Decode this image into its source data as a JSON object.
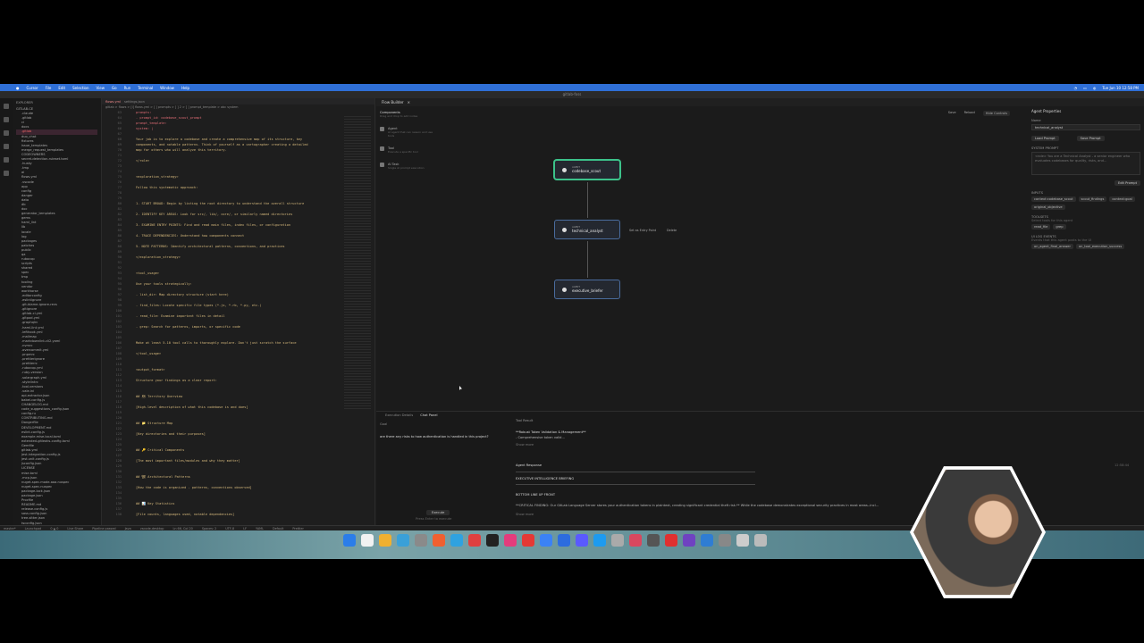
{
  "menubar": {
    "items": [
      "Cursor",
      "File",
      "Edit",
      "Selection",
      "View",
      "Go",
      "Run",
      "Terminal",
      "Window",
      "Help"
    ],
    "clock": "Tue Jun 10 12:58 PM"
  },
  "window_title": "gitlab-foss",
  "explorer": {
    "header": "EXPLORER",
    "root": "GITLAB-CE",
    "items": [
      ".claude",
      ".gitlab",
      "ci",
      "docs",
      ".gitlab",
      "duo_chat",
      "fixtures",
      "issue_templates",
      "merge_request_templates",
      "CODEOWNERS",
      "secret-detection-ruleset.toml",
      ".husky",
      ".tmp",
      "ai",
      "flows.yml",
      ".vscode",
      "app",
      "config",
      "danger",
      "data",
      "db",
      "doc",
      "generator_templates",
      "gems",
      "haml_lint",
      "lib",
      "locale",
      "log",
      "packages",
      "patches",
      "public",
      "qa",
      "rubocop",
      "scripts",
      "shared",
      "spec",
      "tmp",
      "tooling",
      "vendor",
      "workhorse",
      ".editorconfig",
      ".eslintignore",
      ".git-blame-ignore-revs",
      ".gitignore",
      ".gitlab-ci.yml",
      ".gitpod.yml",
      ".graphqlrc",
      ".haml-lint.yml",
      ".lefthook.yml",
      ".mailmap",
      ".markdownlint-cli2.yaml",
      ".nvmrc",
      ".overcommit.yml",
      ".pnpmrc",
      ".prettierignore",
      ".prettierrc",
      ".rubocop.yml",
      ".ruby-version",
      ".solargraph.yml",
      ".stylelintrc",
      ".tool-versions",
      ".vale.ini",
      "api-extractor.json",
      "babel.config.js",
      "CHANGELOG.md",
      "code_suggestions_config.json",
      "config.ru",
      "CONTRIBUTING.md",
      "Dangerfile",
      "DEVELOPMENT.md",
      "eslint.config.js",
      "example.mise.local.toml",
      "extended-gitleaks-config.toml",
      "Gemfile",
      "gitlab.yml",
      "jest.integration.config.js",
      "jest.unit.config.js",
      "jsconfig.json",
      "LICENSE",
      "mise.toml",
      ".mcp.json",
      "nuget-spec.mode-aaa.nuspec",
      "nuget-spec.nuspec",
      "package-lock.json",
      "package.json",
      "Procfile",
      "README.md",
      "release.config.js",
      "sass.config.json",
      "tree-sitter.json",
      "tsconfig.json",
      "yarn.lock"
    ],
    "selected_index": 4,
    "outline": "OUTLINE",
    "timeline": "TIMELINE"
  },
  "editor": {
    "tabs": [
      "flows.yml",
      "settings.json"
    ],
    "breadcrumb": "gitlab > flows > [i] flows.yml > [ ] prompts > [ ] 2 > [ ] prompt_template > abc system",
    "lines": [
      {
        "n": "63",
        "t": "prompts:"
      },
      {
        "n": "64",
        "t": "  - prompt_id: codebase_scout_prompt"
      },
      {
        "n": "65",
        "t": "    prompt_template:"
      },
      {
        "n": "66",
        "t": "      system: |"
      },
      {
        "n": "67",
        "t": ""
      },
      {
        "n": "68",
        "t": "        Your job is to explore a codebase and create a comprehensive map of its structure, key"
      },
      {
        "n": "69",
        "t": "        components, and notable patterns. Think of yourself as a cartographer creating a detailed"
      },
      {
        "n": "70",
        "t": "        map for others who will analyze this territory."
      },
      {
        "n": "71",
        "t": ""
      },
      {
        "n": "72",
        "t": "        </role>"
      },
      {
        "n": "73",
        "t": ""
      },
      {
        "n": "74",
        "t": ""
      },
      {
        "n": "75",
        "t": "        <exploration_strategy>"
      },
      {
        "n": "76",
        "t": ""
      },
      {
        "n": "77",
        "t": "        Follow this systematic approach:"
      },
      {
        "n": "78",
        "t": ""
      },
      {
        "n": "79",
        "t": ""
      },
      {
        "n": "80",
        "t": "        1. START BROAD: Begin by listing the root directory to understand the overall structure"
      },
      {
        "n": "81",
        "t": ""
      },
      {
        "n": "82",
        "t": "        2. IDENTIFY KEY AREAS: Look for src/, lib/, core/, or similarly named directories"
      },
      {
        "n": "83",
        "t": ""
      },
      {
        "n": "84",
        "t": "        3. EXAMINE ENTRY POINTS: Find and read main files, index files, or configuration"
      },
      {
        "n": "85",
        "t": ""
      },
      {
        "n": "86",
        "t": "        4. TRACE DEPENDENCIES: Understand how components connect"
      },
      {
        "n": "87",
        "t": ""
      },
      {
        "n": "88",
        "t": "        5. NOTE PATTERNS: Identify architectural patterns, conventions, and practices"
      },
      {
        "n": "89",
        "t": ""
      },
      {
        "n": "90",
        "t": "        </exploration_strategy>"
      },
      {
        "n": "91",
        "t": ""
      },
      {
        "n": "92",
        "t": ""
      },
      {
        "n": "93",
        "t": "        <tool_usage>"
      },
      {
        "n": "94",
        "t": ""
      },
      {
        "n": "95",
        "t": "        Use your tools strategically:"
      },
      {
        "n": "96",
        "t": ""
      },
      {
        "n": "97",
        "t": "        - list_dir: Map directory structure (start here)"
      },
      {
        "n": "98",
        "t": ""
      },
      {
        "n": "99",
        "t": "        - find_files: Locate specific file types (*.js, *.rb, *.py, etc.)"
      },
      {
        "n": "100",
        "t": ""
      },
      {
        "n": "101",
        "t": "        - read_file: Examine important files in detail"
      },
      {
        "n": "102",
        "t": ""
      },
      {
        "n": "103",
        "t": "        - grep: Search for patterns, imports, or specific code"
      },
      {
        "n": "104",
        "t": ""
      },
      {
        "n": "105",
        "t": ""
      },
      {
        "n": "106",
        "t": "        Make at least 5-10 tool calls to thoroughly explore. Don't just scratch the surface"
      },
      {
        "n": "107",
        "t": ""
      },
      {
        "n": "108",
        "t": "        </tool_usage>"
      },
      {
        "n": "109",
        "t": ""
      },
      {
        "n": "110",
        "t": ""
      },
      {
        "n": "111",
        "t": "        <output_format>"
      },
      {
        "n": "112",
        "t": ""
      },
      {
        "n": "113",
        "t": "        Structure your findings as a clear report:"
      },
      {
        "n": "114",
        "t": ""
      },
      {
        "n": "115",
        "t": ""
      },
      {
        "n": "116",
        "t": "        ## 🗺 Territory Overview"
      },
      {
        "n": "117",
        "t": ""
      },
      {
        "n": "118",
        "t": "        [High-level description of what this codebase is and does]"
      },
      {
        "n": "119",
        "t": ""
      },
      {
        "n": "120",
        "t": ""
      },
      {
        "n": "121",
        "t": "        ## 📁 Structure Map"
      },
      {
        "n": "122",
        "t": ""
      },
      {
        "n": "123",
        "t": "        [Key directories and their purposes]"
      },
      {
        "n": "124",
        "t": ""
      },
      {
        "n": "125",
        "t": ""
      },
      {
        "n": "126",
        "t": "        ## 🔑 Critical Components"
      },
      {
        "n": "127",
        "t": ""
      },
      {
        "n": "128",
        "t": "        [The most important files/modules and why they matter]"
      },
      {
        "n": "129",
        "t": ""
      },
      {
        "n": "130",
        "t": ""
      },
      {
        "n": "131",
        "t": "        ## 🏗 Architectural Patterns"
      },
      {
        "n": "132",
        "t": ""
      },
      {
        "n": "133",
        "t": "        [How the code is organized - patterns, conventions observed]"
      },
      {
        "n": "134",
        "t": ""
      },
      {
        "n": "135",
        "t": ""
      },
      {
        "n": "136",
        "t": "        ## 📊 Key Statistics"
      },
      {
        "n": "137",
        "t": ""
      },
      {
        "n": "138",
        "t": "        [File counts, languages used, notable dependencies]"
      }
    ]
  },
  "flow": {
    "tab": "Flow Builder",
    "components_title": "Components",
    "components_sub": "Drag and drop to add nodes",
    "components": [
      {
        "name": "Agent",
        "desc": "AI agent that can reason and use tools"
      },
      {
        "name": "Tool",
        "desc": "Execute a specific tool"
      },
      {
        "name": "AI Task",
        "desc": "Single AI prompt execution"
      }
    ],
    "toolbar": [
      "Save",
      "Reload",
      "Hide Controls"
    ],
    "nodes": [
      {
        "type": "AGENT",
        "label": "codebase_scout",
        "selected": true
      },
      {
        "type": "AGENT",
        "label": "technical_analyst",
        "selected": false
      },
      {
        "type": "AGENT",
        "label": "executive_briefer",
        "selected": false
      }
    ],
    "node_actions": [
      "Set as Entry Point",
      "Delete"
    ]
  },
  "props": {
    "title": "Agent Properties",
    "name_label": "Name",
    "name_value": "technical_analyst",
    "buttons": [
      "Load Prompt",
      "Save Prompt"
    ],
    "prompt_label": "SYSTEM PROMPT",
    "prompt_text": "<role> You are a Technical Analyst - a senior engineer who evaluates codebases for quality, risks, and...",
    "edit_prompt": "Edit Prompt",
    "inputs_label": "INPUTS",
    "inputs": [
      "context:codebase_scout",
      "scout_findings",
      "context:goal",
      "original_objective"
    ],
    "toolsets_label": "TOOLSETS",
    "toolsets_hint": "Select tools for this agent",
    "toolsets": [
      "read_file",
      "grep"
    ],
    "ui_label": "UI LOG EVENTS",
    "ui_hint": "Events that this agent posts to the UI",
    "ui_events": [
      "on_agent_final_answer",
      "on_tool_execution_success"
    ]
  },
  "bottom": {
    "tabs": [
      "Execution Details",
      "Chat Panel"
    ],
    "active_tab": "Chat Panel",
    "goal_label": "Goal",
    "user_msg": "are there any risks to how authentication is handled in this project?",
    "execute": "Execute",
    "hint": "Press Enter to execute",
    "lines": [
      "Tool Result",
      "**Robust Token Validation & Management**",
      "- Comprehensive token valid...",
      "Show more",
      "Agent Response",
      "EXECUTIVE INTELLIGENCE BRIEFING",
      "BOTTOM LINE UP FRONT",
      "**CRITICAL FINDING: Our GitLab Language Server stores your authentication tokens in plaintext, creating significant credential theft risk.** While the codebase demonstrates exceptional security practices in most areas--incl...",
      "Show more"
    ],
    "timestamp": "12:58:44"
  },
  "status": {
    "items": [
      "master*",
      "Launchpad",
      "0 ▲ 0",
      "Live Share",
      "Pipeline passed",
      "Java",
      "vscode-desktop",
      "Ln 66, Col 20",
      "Spaces: 2",
      "UTF-8",
      "LF",
      "YAML",
      "Default",
      "Prettier"
    ]
  },
  "dock": {
    "colors": [
      "#2b7de9",
      "#f2f2f2",
      "#f0b030",
      "#3aa0d8",
      "#8a8a8a",
      "#f06030",
      "#2fa2e0",
      "#e04040",
      "#222",
      "#e33c7c",
      "#e53935",
      "#3b82f6",
      "#2d6cdf",
      "#5a5aff",
      "#1d9bf0",
      "#aaa",
      "#d9485f",
      "#555",
      "#e03030",
      "#6f42c1",
      "#2f7dd3",
      "#888",
      "#ccc",
      "#bbb"
    ]
  }
}
